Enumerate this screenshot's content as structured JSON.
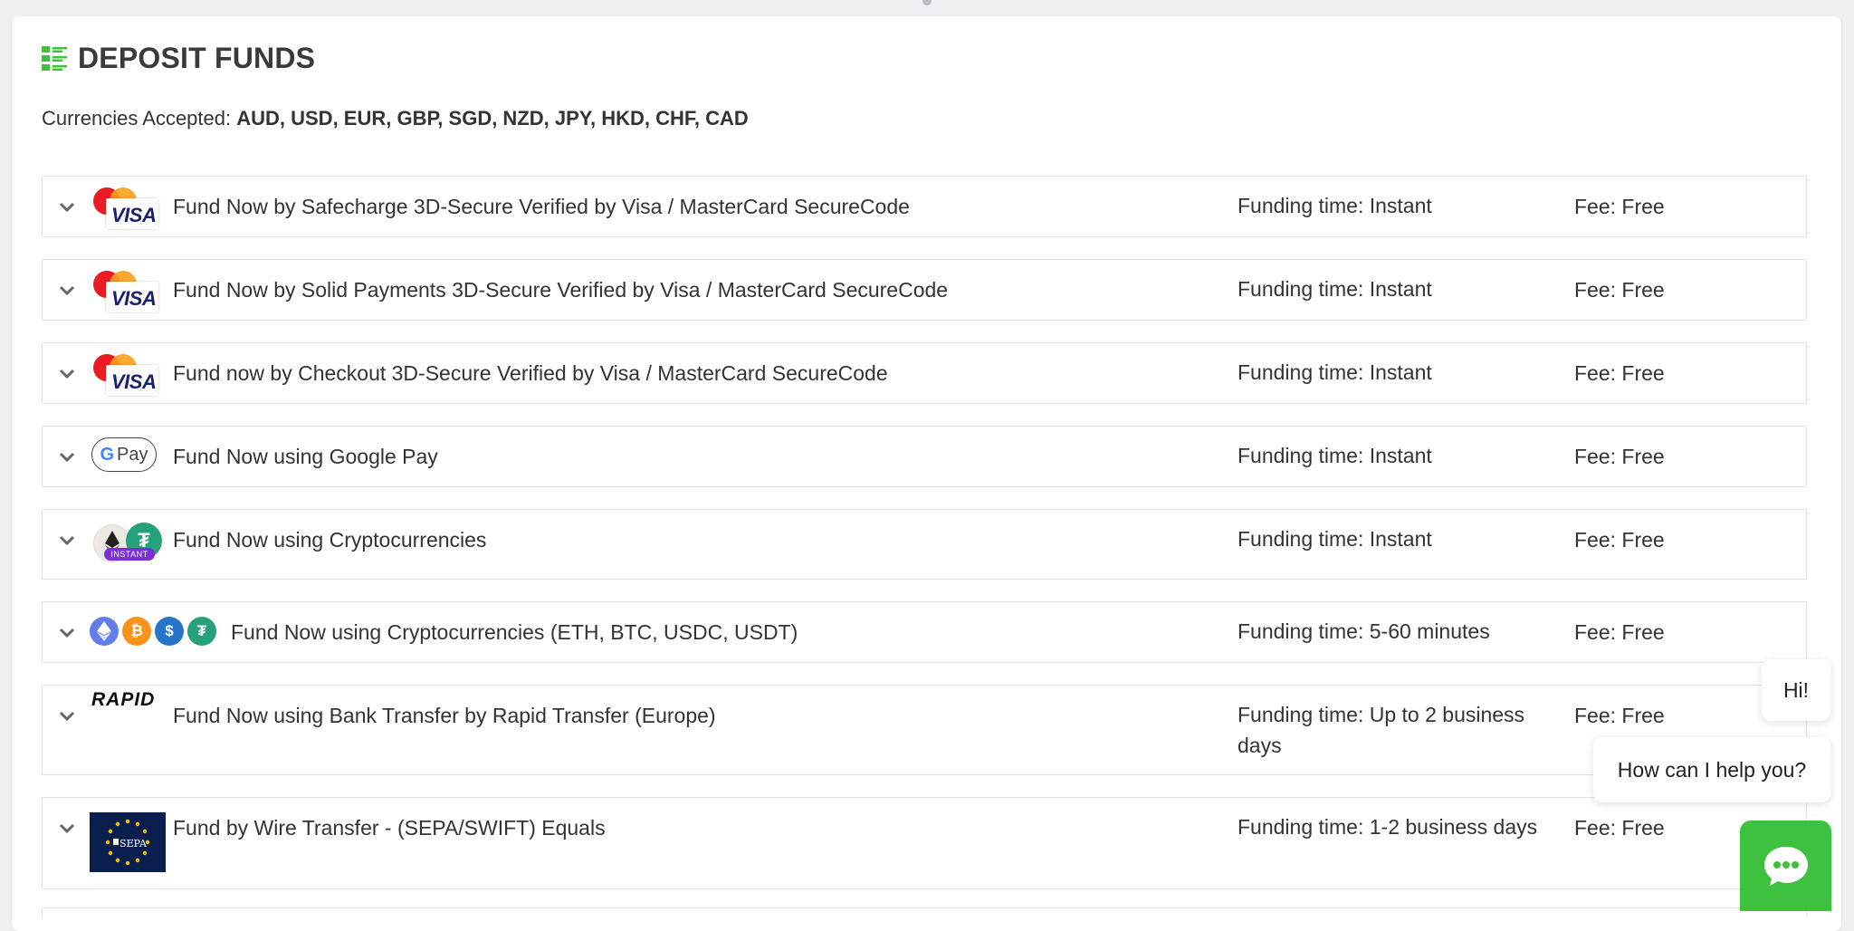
{
  "header": {
    "title": "DEPOSIT FUNDS",
    "currencies_label": "Currencies Accepted:",
    "currencies_list": "AUD, USD, EUR, GBP, SGD, NZD, JPY, HKD, CHF, CAD"
  },
  "colors": {
    "accent_green": "#3ec13e",
    "title_icon_green": "#3ec13e"
  },
  "methods": [
    {
      "icon": "visa-mastercard-icon",
      "name": "Fund Now by Safecharge 3D-Secure Verified by Visa / MasterCard SecureCode",
      "time": "Funding time: Instant",
      "fee": "Fee: Free"
    },
    {
      "icon": "visa-mastercard-icon",
      "name": "Fund Now by Solid Payments 3D-Secure Verified by Visa / MasterCard SecureCode",
      "time": "Funding time: Instant",
      "fee": "Fee: Free"
    },
    {
      "icon": "visa-mastercard-icon",
      "name": "Fund now by Checkout 3D-Secure Verified by Visa / MasterCard SecureCode",
      "time": "Funding time: Instant",
      "fee": "Fee: Free"
    },
    {
      "icon": "google-pay-icon",
      "name": "Fund Now using Google Pay",
      "time": "Funding time: Instant",
      "fee": "Fee: Free",
      "logo_text": "Pay",
      "logo_g": "G"
    },
    {
      "icon": "crypto-instant-icon",
      "name": "Fund Now using Cryptocurrencies",
      "time": "Funding time: Instant",
      "fee": "Fee: Free",
      "badge": "INSTANT"
    },
    {
      "icon": "crypto-coins-icon",
      "name": "Fund Now using Cryptocurrencies (ETH, BTC, USDC, USDT)",
      "time": "Funding time: 5-60 minutes",
      "fee": "Fee: Free"
    },
    {
      "icon": "rapid-transfer-icon",
      "name": "Fund Now using Bank Transfer by Rapid Transfer (Europe)",
      "time": "Funding time: Up to 2 business days",
      "fee": "Fee: Free",
      "logo_text": "RAPID"
    },
    {
      "icon": "sepa-icon",
      "name": "Fund by Wire Transfer - (SEPA/SWIFT) Equals",
      "time": "Funding time: 1-2 business days",
      "fee": "Fee: Free",
      "logo_text": "SEPA"
    }
  ],
  "card_logo_text": "VISA",
  "chat": {
    "greeting": "Hi!",
    "prompt": "How can I help you?"
  }
}
